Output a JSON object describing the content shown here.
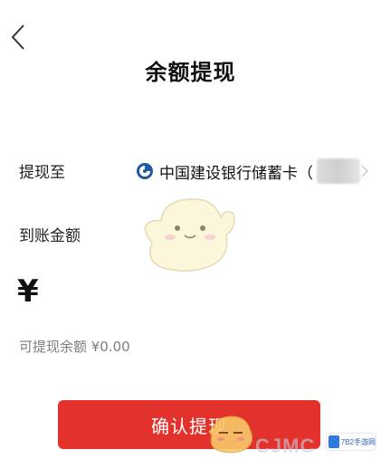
{
  "header": {
    "title": "余额提现"
  },
  "form": {
    "withdraw_to_label": "提现至",
    "bank_name": "中国建设银行储蓄卡（",
    "received_label": "到账金额",
    "currency_symbol": "¥",
    "amount_value": "",
    "available_balance_text": "可提现余额 ¥0.00"
  },
  "footer": {
    "confirm_label": "确认提现"
  },
  "watermark": {
    "text": "CJMC",
    "site_badge": "7B2手游网"
  },
  "colors": {
    "accent": "#e3312c",
    "bank_logo": "#1f5aa6",
    "muted_text": "#7d7d7d"
  },
  "icons": {
    "back": "chevron-left-icon",
    "bank": "ccb-logo-icon",
    "chevron": "chevron-right-icon"
  }
}
